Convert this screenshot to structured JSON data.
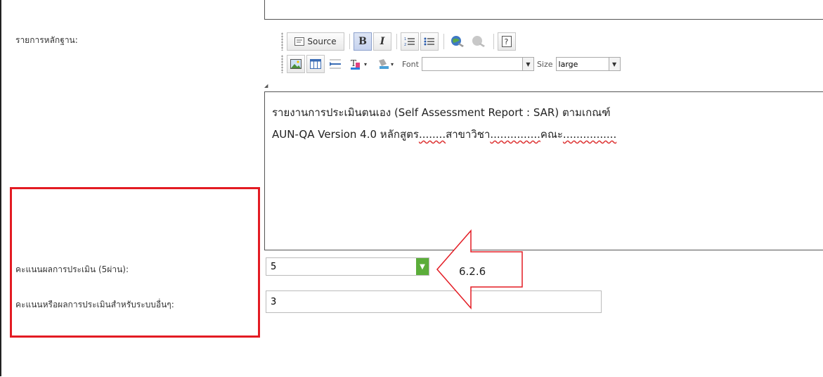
{
  "form": {
    "evidence_label": "รายการหลักฐาน:",
    "score_label": "คะแนนผลการประเมิน (5ผ่าน):",
    "other_score_label": "คะแนนหรือผลการประเมินสำหรับระบบอื่นๆ:",
    "score_value": "5",
    "other_score_value": "3"
  },
  "toolbar": {
    "source_label": "Source",
    "bold_label": "B",
    "italic_label": "I",
    "font_label": "Font",
    "font_value": "",
    "size_label": "Size",
    "size_value": "large"
  },
  "editor": {
    "line1": "รายงานการประเมินตนเอง (Self Assessment Report : SAR) ตามเกณฑ์",
    "line2_a": "AUN-QA Version 4.0 หลักสูตร",
    "blank1": "........",
    "line2_b": "สาขาวิชา",
    "blank2": "...............",
    "line2_c": "คณะ",
    "blank3": "................"
  },
  "annotation": {
    "label": "6.2.6",
    "color": "#e31b23"
  }
}
